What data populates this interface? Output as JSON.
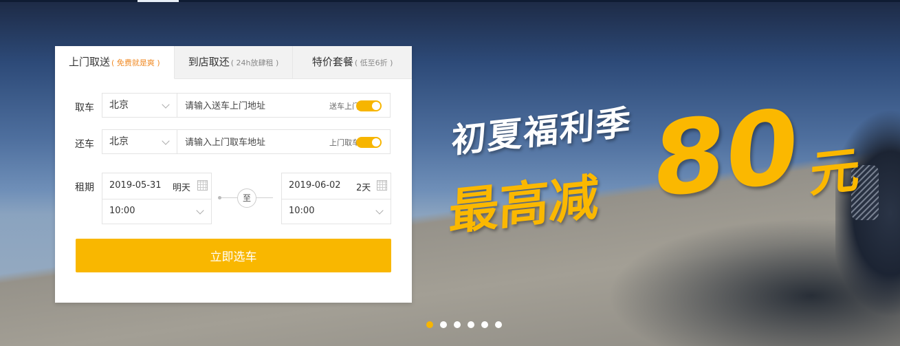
{
  "tabs": [
    {
      "label": "上门取送",
      "sub": "( 免费就是爽 )"
    },
    {
      "label": "到店取还",
      "sub": "( 24h放肆租 )"
    },
    {
      "label": "特价套餐",
      "sub": "( 低至6折 )"
    }
  ],
  "pickup": {
    "label": "取车",
    "city": "北京",
    "placeholder": "请输入送车上门地址",
    "toggle_label": "送车上门",
    "toggle_on": true
  },
  "return": {
    "label": "还车",
    "city": "北京",
    "placeholder": "请输入上门取车地址",
    "toggle_label": "上门取车",
    "toggle_on": true
  },
  "period": {
    "label": "租期",
    "start_date": "2019-05-31",
    "start_day": "明天",
    "start_time": "10:00",
    "to_label": "至",
    "end_date": "2019-06-02",
    "duration": "2天",
    "end_time": "10:00"
  },
  "submit_label": "立即选车",
  "promo": {
    "line1": "初夏福利季",
    "line2": "最高减",
    "amount": "80",
    "unit": "元"
  },
  "carousel": {
    "count": 6,
    "active": 0
  },
  "colors": {
    "accent": "#f9b700",
    "promo_yellow": "#fbb800"
  }
}
